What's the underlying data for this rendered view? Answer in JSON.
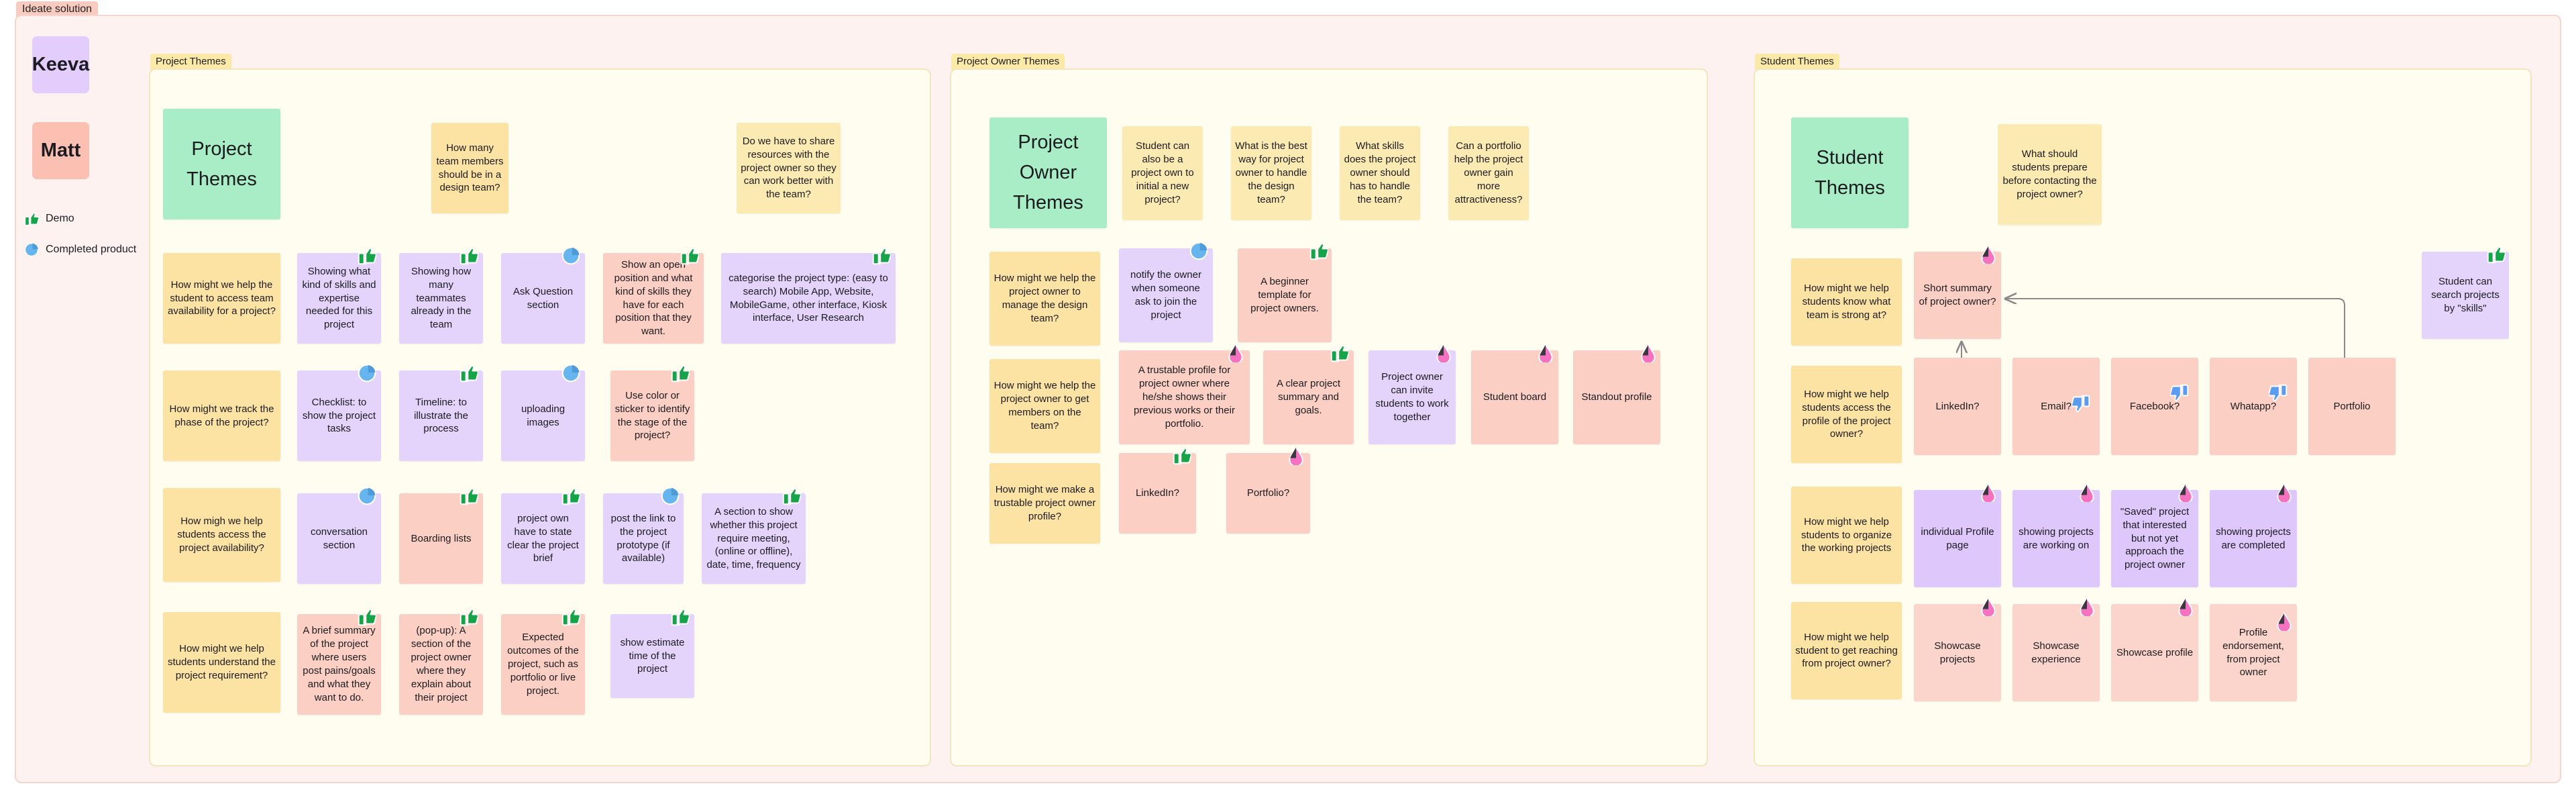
{
  "board": {
    "section_label": "Ideate solution",
    "frames": [
      {
        "id": "project",
        "label": "Project Themes"
      },
      {
        "id": "project_owner",
        "label": "Project Owner Themes"
      },
      {
        "id": "student",
        "label": "Student Themes"
      }
    ]
  },
  "rail": {
    "cards": [
      {
        "name": "Keeva",
        "color": "#e3cdfd"
      },
      {
        "name": "Matt",
        "color": "#fbc0b2"
      }
    ],
    "legend": [
      {
        "icon": "thumbs-up-icon",
        "label": "Demo",
        "color": "#16a34a"
      },
      {
        "icon": "blue-circle-sticker",
        "label": "Completed product",
        "color": "#66b5ef"
      }
    ]
  },
  "colors": {
    "section_bg": "#fdf2ef",
    "section_tag": "#f8cbc0",
    "frame_bg": "#fffcf0",
    "frame_tag": "#fbe9a8",
    "note_purple": "#e4d3fb",
    "note_yellow": "#fce3a4",
    "note_pink": "#fbcfc4",
    "note_green": "#a8edc6",
    "sticker_demo": "#16a34a",
    "sticker_completed": "#66b5ef",
    "sticker_pink": "#f472c0",
    "sticker_thumbs_down": "#5b9bf0"
  },
  "columns": {
    "project": {
      "title": "Project Themes",
      "loose_notes": [
        {
          "text": "How many team members should be in a design team?",
          "color": "yellow"
        },
        {
          "text": "Do we have to share resources with the project owner so they can work better with the team?",
          "color": "lyellow"
        }
      ],
      "rows": [
        {
          "question": "How might we help the student to access team availability for a project?",
          "notes": [
            {
              "text": "Showing what kind of skills and expertise needed for this project",
              "color": "purple",
              "sticker": "demo"
            },
            {
              "text": "Showing how many teammates already in the team",
              "color": "purple",
              "sticker": "demo"
            },
            {
              "text": "Ask Question section",
              "color": "purple",
              "sticker": "completed"
            },
            {
              "text": "Show an open position and what kind of skills they have for each position that they want.",
              "color": "pink",
              "sticker": "demo"
            },
            {
              "text": "categorise the project type: (easy to search) Mobile App, Website, MobileGame, other interface, Kiosk interface, User Research",
              "color": "purple",
              "sticker": "demo"
            }
          ]
        },
        {
          "question": "How might we track the phase of the project?",
          "notes": [
            {
              "text": "Checklist: to show the project tasks",
              "color": "purple",
              "sticker": "completed"
            },
            {
              "text": "Timeline: to illustrate the process",
              "color": "purple",
              "sticker": "demo"
            },
            {
              "text": "uploading images",
              "color": "purple",
              "sticker": "completed"
            },
            {
              "text": "Use color or sticker to identify the stage of the project?",
              "color": "pink",
              "sticker": "demo"
            }
          ]
        },
        {
          "question": "How migh we help students access the project availability?",
          "notes": [
            {
              "text": "conversation section",
              "color": "purple",
              "sticker": "completed"
            },
            {
              "text": "Boarding lists",
              "color": "pink",
              "sticker": "demo"
            },
            {
              "text": "project own have to state clear the project brief",
              "color": "purple",
              "sticker": "demo"
            },
            {
              "text": "post the link to the project prototype (if available)",
              "color": "purple",
              "sticker": "completed"
            },
            {
              "text": "A section to show whether this project require meeting, (online or offline), date, time, frequency",
              "color": "purple",
              "sticker": "demo"
            }
          ]
        },
        {
          "question": "How might we help students understand the project requirement?",
          "notes": [
            {
              "text": "A brief summary of the project where users post pains/goals and what they want to do.",
              "color": "pink",
              "sticker": "demo"
            },
            {
              "text": "(pop-up): A section of the project owner where they explain about their project",
              "color": "pink",
              "sticker": "demo"
            },
            {
              "text": "Expected outcomes of the project, such as portfolio or live project.",
              "color": "pink",
              "sticker": "demo"
            },
            {
              "text": "show estimate time of the project",
              "color": "purple",
              "sticker": "demo"
            }
          ]
        }
      ]
    },
    "project_owner": {
      "title": "Project Owner Themes",
      "loose_notes": [
        {
          "text": "Student can also be a project own to initial a new project?",
          "color": "lyellow"
        },
        {
          "text": "What is the best way for project owner to handle the design team?",
          "color": "lyellow"
        },
        {
          "text": "What skills does the project owner should has to handle the team?",
          "color": "lyellow"
        },
        {
          "text": "Can a portfolio help the project owner gain more attractiveness?",
          "color": "lyellow"
        }
      ],
      "rows": [
        {
          "question": "How might we help the project owner to manage the design team?",
          "notes": [
            {
              "text": "notify the owner when someone ask to join the project",
              "color": "purple",
              "sticker": "completed"
            },
            {
              "text": "A beginner template for project owners.",
              "color": "pink",
              "sticker": "demo"
            }
          ]
        },
        {
          "question": "How might we help the project owner to get members on the team?",
          "notes": [
            {
              "text": "A trustable profile for project owner where he/she shows their previous works or their portfolio.",
              "color": "pink",
              "sticker": "pink"
            },
            {
              "text": "A clear project summary and goals.",
              "color": "pink",
              "sticker": "demo"
            },
            {
              "text": "Project owner can invite students to work together",
              "color": "purple",
              "sticker": "pink"
            },
            {
              "text": "Student board",
              "color": "pink",
              "sticker": "pink"
            },
            {
              "text": "Standout profile",
              "color": "pink",
              "sticker": "pink"
            }
          ]
        },
        {
          "question": "How might we make a trustable project owner profile?",
          "notes": [
            {
              "text": "LinkedIn?",
              "color": "pink",
              "sticker": "demo"
            },
            {
              "text": "Portfolio?",
              "color": "pink",
              "sticker": "pink"
            }
          ]
        }
      ]
    },
    "student": {
      "title": "Student Themes",
      "loose_notes": [
        {
          "text": "What should students prepare before contacting the project owner?",
          "color": "lyellow"
        }
      ],
      "rows": [
        {
          "question": "How might we help students know what team is strong at?",
          "notes": [
            {
              "text": "Short summary of project owner?",
              "color": "pink",
              "sticker": "pink"
            },
            {
              "text": "Student can search projects by \"skills\"",
              "color": "purple",
              "sticker": "demo"
            }
          ]
        },
        {
          "question": "How might we help students access the profile of the project owner?",
          "notes": [
            {
              "text": "LinkedIn?",
              "color": "pink",
              "sticker": "none"
            },
            {
              "text": "Email?",
              "color": "pink",
              "sticker": "thumbs-down"
            },
            {
              "text": "Facebook?",
              "color": "pink",
              "sticker": "thumbs-down"
            },
            {
              "text": "Whatapp?",
              "color": "pink",
              "sticker": "thumbs-down"
            },
            {
              "text": "Portfolio",
              "color": "pink",
              "sticker": "none"
            }
          ]
        },
        {
          "question": "How might we help students to organize the working projects",
          "notes": [
            {
              "text": "individual Profile page",
              "color": "purple",
              "sticker": "pink"
            },
            {
              "text": "showing projects are working on",
              "color": "purple",
              "sticker": "pink"
            },
            {
              "text": "\"Saved\" project that interested but not yet approach the project owner",
              "color": "purple",
              "sticker": "pink"
            },
            {
              "text": "showing projects are completed",
              "color": "purple",
              "sticker": "pink"
            }
          ]
        },
        {
          "question": "How might we help student to get reaching from project owner?",
          "notes": [
            {
              "text": "Showcase projects",
              "color": "pink",
              "sticker": "pink"
            },
            {
              "text": "Showcase experience",
              "color": "pink",
              "sticker": "pink"
            },
            {
              "text": "Showcase profile",
              "color": "pink",
              "sticker": "pink"
            },
            {
              "text": "Profile endorsement, from project owner",
              "color": "pink",
              "sticker": "pink"
            }
          ]
        }
      ]
    }
  }
}
